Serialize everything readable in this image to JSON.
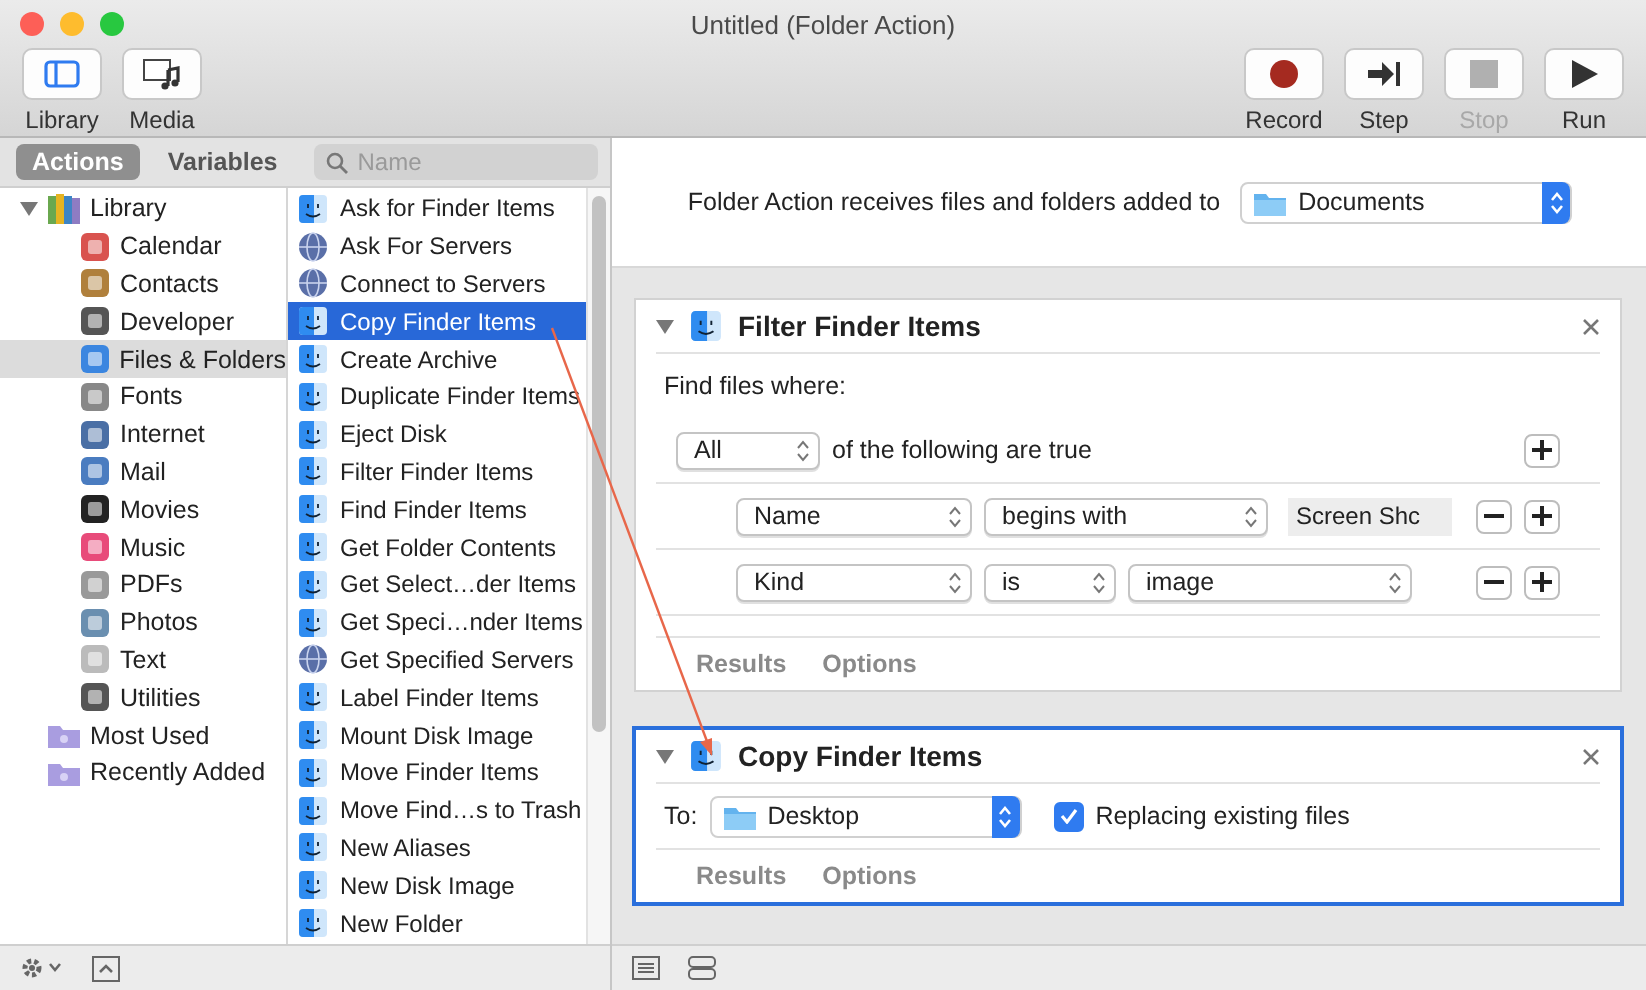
{
  "window": {
    "title": "Untitled (Folder Action)"
  },
  "toolbar": {
    "left": [
      {
        "label": "Library",
        "kind": "library"
      },
      {
        "label": "Media",
        "kind": "media"
      }
    ],
    "right": [
      {
        "label": "Record",
        "kind": "record",
        "disabled": false
      },
      {
        "label": "Step",
        "kind": "step",
        "disabled": false
      },
      {
        "label": "Stop",
        "kind": "stop",
        "disabled": true
      },
      {
        "label": "Run",
        "kind": "run",
        "disabled": false
      }
    ]
  },
  "tabs": [
    {
      "label": "Actions",
      "selected": true
    },
    {
      "label": "Variables",
      "selected": false
    }
  ],
  "search": {
    "placeholder": "Name"
  },
  "categories": [
    {
      "label": "Library",
      "expanded": true,
      "selected": false,
      "children": [
        {
          "label": "Calendar",
          "selected": false
        },
        {
          "label": "Contacts",
          "selected": false
        },
        {
          "label": "Developer",
          "selected": false
        },
        {
          "label": "Files & Folders",
          "selected": true
        },
        {
          "label": "Fonts",
          "selected": false
        },
        {
          "label": "Internet",
          "selected": false
        },
        {
          "label": "Mail",
          "selected": false
        },
        {
          "label": "Movies",
          "selected": false
        },
        {
          "label": "Music",
          "selected": false
        },
        {
          "label": "PDFs",
          "selected": false
        },
        {
          "label": "Photos",
          "selected": false
        },
        {
          "label": "Text",
          "selected": false
        },
        {
          "label": "Utilities",
          "selected": false
        }
      ]
    },
    {
      "label": "Most Used",
      "selected": false
    },
    {
      "label": "Recently Added",
      "selected": false
    }
  ],
  "actions": [
    {
      "label": "Ask for Finder Items",
      "kind": "finder",
      "selected": false
    },
    {
      "label": "Ask For Servers",
      "kind": "globe",
      "selected": false
    },
    {
      "label": "Connect to Servers",
      "kind": "globe",
      "selected": false
    },
    {
      "label": "Copy Finder Items",
      "kind": "finder",
      "selected": true
    },
    {
      "label": "Create Archive",
      "kind": "finder",
      "selected": false
    },
    {
      "label": "Duplicate Finder Items",
      "kind": "finder",
      "selected": false
    },
    {
      "label": "Eject Disk",
      "kind": "finder",
      "selected": false
    },
    {
      "label": "Filter Finder Items",
      "kind": "finder",
      "selected": false
    },
    {
      "label": "Find Finder Items",
      "kind": "finder",
      "selected": false
    },
    {
      "label": "Get Folder Contents",
      "kind": "finder",
      "selected": false
    },
    {
      "label": "Get Select…der Items",
      "kind": "finder",
      "selected": false
    },
    {
      "label": "Get Speci…nder Items",
      "kind": "finder",
      "selected": false
    },
    {
      "label": "Get Specified Servers",
      "kind": "globe",
      "selected": false
    },
    {
      "label": "Label Finder Items",
      "kind": "finder",
      "selected": false
    },
    {
      "label": "Mount Disk Image",
      "kind": "finder",
      "selected": false
    },
    {
      "label": "Move Finder Items",
      "kind": "finder",
      "selected": false
    },
    {
      "label": "Move Find…s to Trash",
      "kind": "finder",
      "selected": false
    },
    {
      "label": "New Aliases",
      "kind": "finder",
      "selected": false
    },
    {
      "label": "New Disk Image",
      "kind": "finder",
      "selected": false
    },
    {
      "label": "New Folder",
      "kind": "finder",
      "selected": false
    }
  ],
  "workflow": {
    "header": {
      "text": "Folder Action receives files and folders added to",
      "folder": "Documents"
    },
    "cards": [
      {
        "kind": "filter",
        "title": "Filter Finder Items",
        "selected": false,
        "prompt": "Find files where:",
        "match": "All",
        "match_text": "of the following are true",
        "conditions": [
          {
            "kind": "text",
            "field": "Name",
            "operator": "begins with",
            "value": "Screen Shc"
          },
          {
            "kind": "popup",
            "field": "Kind",
            "operator": "is",
            "value": "image"
          }
        ],
        "tabs": [
          "Results",
          "Options"
        ]
      },
      {
        "kind": "copy",
        "title": "Copy Finder Items",
        "selected": true,
        "to_label": "To:",
        "destination": "Desktop",
        "replace": {
          "label": "Replacing existing files",
          "checked": true
        },
        "tabs": [
          "Results",
          "Options"
        ]
      }
    ]
  }
}
